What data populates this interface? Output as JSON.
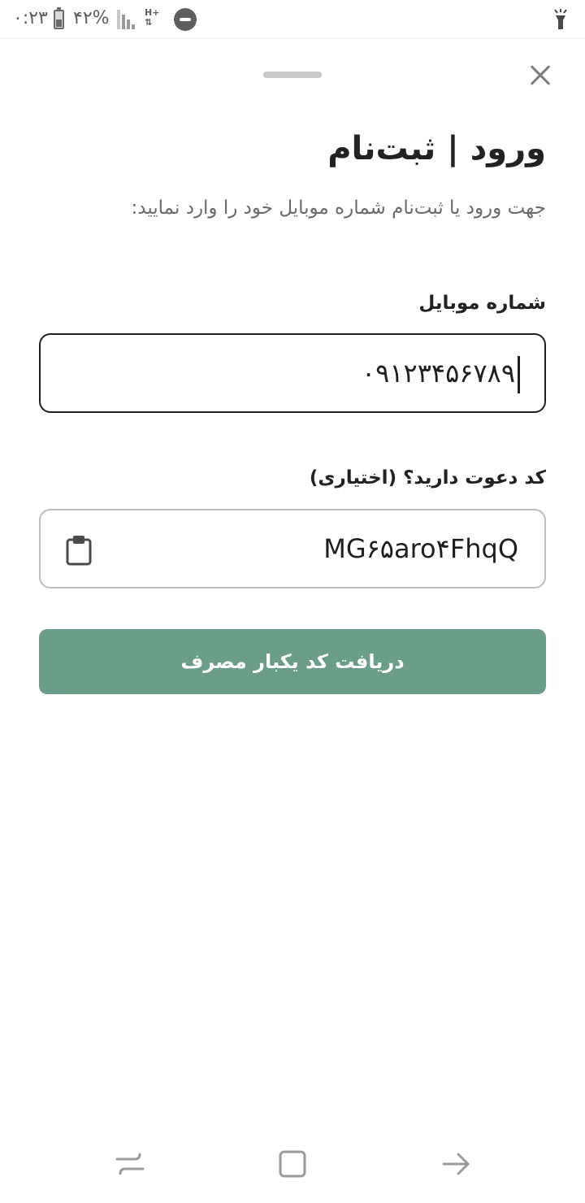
{
  "status_bar": {
    "time": "۰:۲۳",
    "battery": "۴۲%",
    "network_type": "H+",
    "icons": [
      "battery-icon",
      "signal-icon",
      "hplus-icon",
      "dnd-icon",
      "flashlight-icon"
    ]
  },
  "sheet": {
    "title": "ورود | ثبت‌نام",
    "subtitle": "جهت ورود یا ثبت‌نام شماره موبایل خود را وارد نمایید:",
    "mobile_field": {
      "label": "شماره موبایل",
      "value": "۰۹۱۲۳۴۵۶۷۸۹"
    },
    "invite_field": {
      "label": "کد دعوت دارید؟ (اختیاری)",
      "value": "MG۶۵aro۴FhqQ",
      "icon": "clipboard-icon"
    },
    "submit_label": "دریافت کد یکبار مصرف"
  },
  "nav_bar": {
    "icons": [
      "recent-apps-icon",
      "home-icon",
      "back-icon"
    ]
  },
  "colors": {
    "accent": "#6a9e89",
    "text_primary": "#222222",
    "text_secondary": "#6a6a6a",
    "input_border_focused": "#1f1f1f",
    "input_border": "#bdbdbd"
  }
}
